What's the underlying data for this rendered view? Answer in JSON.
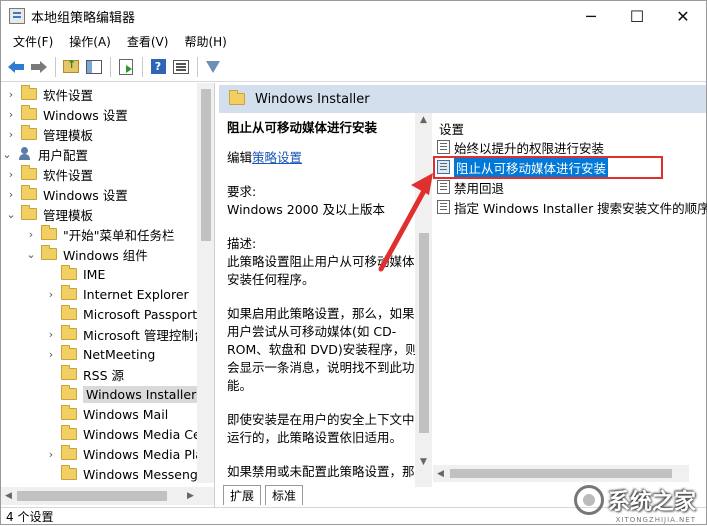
{
  "window": {
    "title": "本地组策略编辑器",
    "minimize_glyph": "─",
    "maximize_glyph": "☐",
    "close_glyph": "✕"
  },
  "menu": [
    "文件(F)",
    "操作(A)",
    "查看(V)",
    "帮助(H)"
  ],
  "toolbar": {
    "icons": [
      "back-arrow-icon",
      "forward-arrow-icon",
      "up-folder-icon",
      "show-hide-tree-icon",
      "export-list-icon",
      "help-icon",
      "properties-icon",
      "filter-icon"
    ],
    "help_glyph": "?"
  },
  "tree": {
    "items": [
      {
        "label": "软件设置",
        "type": "folder",
        "expander": "›"
      },
      {
        "label": "Windows 设置",
        "type": "folder",
        "expander": "›"
      },
      {
        "label": "管理模板",
        "type": "folder",
        "expander": "›"
      },
      {
        "label": "用户配置",
        "type": "user",
        "expander": "⌄"
      },
      {
        "label": "软件设置",
        "type": "folder",
        "expander": "›"
      },
      {
        "label": "Windows 设置",
        "type": "folder",
        "expander": "›"
      },
      {
        "label": "管理模板",
        "type": "folder",
        "expander": "⌄"
      },
      {
        "label": "\"开始\"菜单和任务栏",
        "type": "folder",
        "expander": "›"
      },
      {
        "label": "Windows 组件",
        "type": "folder",
        "expander": "⌄"
      },
      {
        "label": "IME",
        "type": "folder",
        "expander": ""
      },
      {
        "label": "Internet Explorer",
        "type": "folder",
        "expander": "›"
      },
      {
        "label": "Microsoft Passport",
        "type": "folder",
        "expander": ""
      },
      {
        "label": "Microsoft 管理控制台",
        "type": "folder",
        "expander": "›"
      },
      {
        "label": "NetMeeting",
        "type": "folder",
        "expander": "›"
      },
      {
        "label": "RSS 源",
        "type": "folder",
        "expander": ""
      },
      {
        "label": "Windows Installer",
        "type": "folder",
        "expander": "",
        "selected": true
      },
      {
        "label": "Windows Mail",
        "type": "folder",
        "expander": ""
      },
      {
        "label": "Windows Media Ce",
        "type": "folder",
        "expander": ""
      },
      {
        "label": "Windows Media Pla",
        "type": "folder",
        "expander": "›"
      },
      {
        "label": "Windows Messenge",
        "type": "folder",
        "expander": ""
      }
    ]
  },
  "right": {
    "header": "Windows Installer",
    "description": {
      "title": "阻止从可移动媒体进行安装",
      "edit_prefix": "编辑",
      "edit_link": "策略设置",
      "req_label": "要求:",
      "req_value": "Windows 2000 及以上版本",
      "desc_label": "描述:",
      "desc_text": "此策略设置阻止用户从可移动媒体安装任何程序。",
      "p1": "如果启用此策略设置，那么，如果用户尝试从可移动媒体(如 CD-ROM、软盘和 DVD)安装程序，则会显示一条消息，说明找不到此功能。",
      "p2": "即使安装是在用户的安全上下文中运行的，此策略设置依旧适用。",
      "p3": "如果禁用或未配置此策略设置，那么，如果安装是在用户安全上下文中"
    },
    "settings_header": "设置",
    "settings": [
      {
        "label": "始终以提升的权限进行安装"
      },
      {
        "label": "阻止从可移动媒体进行安装",
        "highlighted": true
      },
      {
        "label": "禁用回退"
      },
      {
        "label": "指定 Windows Installer 搜索安装文件的顺序"
      }
    ],
    "tabs": [
      "扩展",
      "标准"
    ]
  },
  "status": "4 个设置",
  "watermark": {
    "text": "系统之家",
    "sub": "XITONGZHIJIA.NET"
  },
  "colors": {
    "selection": "#0078d7",
    "annotation_red": "#e02f2f",
    "header_bg": "#d3dfec",
    "link": "#1a57b6"
  }
}
